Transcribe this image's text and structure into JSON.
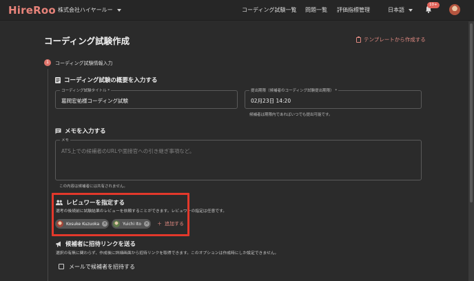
{
  "topbar": {
    "logo": "HireRoo",
    "company": "株式会社ハイヤールー",
    "nav": [
      "コーディング試験一覧",
      "問題一覧",
      "評価指標管理"
    ],
    "language": "日本語",
    "notification_badge": "10+"
  },
  "page": {
    "title": "コーディング試験作成",
    "template_button": "テンプレートから作成する"
  },
  "step": {
    "number": "1",
    "label": "コーディング試験情報入力"
  },
  "overview": {
    "heading": "コーディング試験の概要を入力する",
    "title_label": "コーディング試験タイトル *",
    "title_value": "葛岡宏祐様コーディング試験",
    "deadline_label": "提出期限（候補者のコーディング試験提出期限） *",
    "deadline_value": "02月23日 14:20",
    "deadline_help": "候補者は期限内であればいつでも提出可能です。"
  },
  "memo": {
    "heading": "メモを入力する",
    "label": "メモ",
    "placeholder": "ATS上での候補者のURLや面接官への引き継ぎ事項など。",
    "help": "この内容は候補者には共有されません。"
  },
  "reviewer": {
    "heading": "レビュワーを指定する",
    "description": "選考の後続前に試験結果のレビューを依頼することができます。レビュワーの指定は任意です。",
    "chips": [
      {
        "name": "Kosuke Kuzuoka"
      },
      {
        "name": "Yuichi Ito"
      }
    ],
    "add_label": "追加する"
  },
  "invite": {
    "heading": "候補者に招待リンクを送る",
    "description": "選択の有無に関わらず、作成後に詳細画面から招待リンクを取得できます。このオプションは作成時にしか設定できません。",
    "checkbox_label": "メールで候補者を招待する"
  },
  "colors": {
    "accent": "#e0756c",
    "highlight": "#e3382b",
    "background": "#2b2b2b"
  }
}
